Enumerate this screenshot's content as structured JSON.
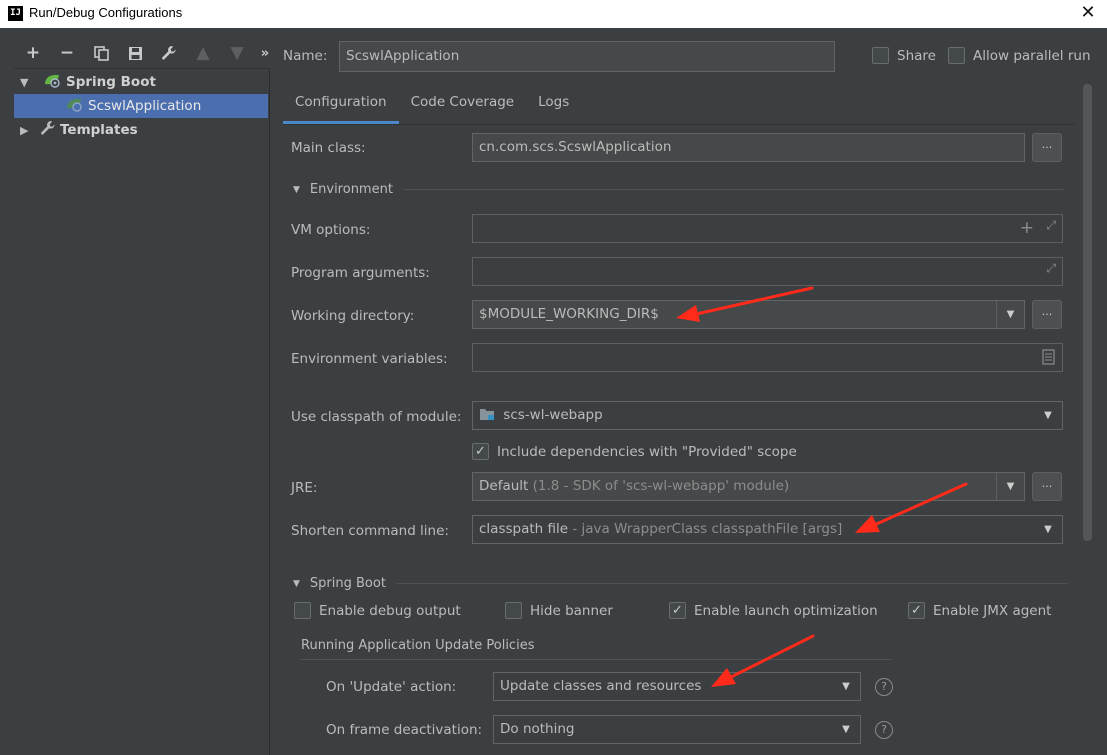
{
  "window": {
    "title": "Run/Debug Configurations",
    "app_icon": "IJ"
  },
  "toolbar": {
    "icons": [
      "add-icon",
      "remove-icon",
      "copy-icon",
      "save-icon",
      "wrench-icon",
      "move-up-icon",
      "move-down-icon",
      "more-icon"
    ]
  },
  "tree": {
    "spring_boot": "Spring Boot",
    "app": "ScswlApplication",
    "templates": "Templates"
  },
  "header": {
    "name_label": "Name:",
    "name_value": "ScswlApplication",
    "share_label": "Share",
    "parallel_label": "Allow parallel run"
  },
  "tabs": [
    "Configuration",
    "Code Coverage",
    "Logs"
  ],
  "config": {
    "main_class_label": "Main class:",
    "main_class_value": "cn.com.scs.ScswlApplication",
    "environment_section": "Environment",
    "vm_options_label": "VM options:",
    "program_args_label": "Program arguments:",
    "working_dir_label": "Working directory:",
    "working_dir_value": "$MODULE_WORKING_DIR$",
    "env_vars_label": "Environment variables:",
    "classpath_label": "Use classpath of module:",
    "classpath_value": "scs-wl-webapp",
    "include_deps_label": "Include dependencies with \"Provided\" scope",
    "jre_label": "JRE:",
    "jre_value": "Default",
    "jre_detail": "(1.8 - SDK of 'scs-wl-webapp' module)",
    "shorten_label": "Shorten command line:",
    "shorten_value": "classpath file",
    "shorten_detail": "- java WrapperClass classpathFile [args]"
  },
  "spring_boot": {
    "section": "Spring Boot",
    "debug_output": "Enable debug output",
    "hide_banner": "Hide banner",
    "launch_opt": "Enable launch optimization",
    "jmx_agent": "Enable JMX agent",
    "policies_title": "Running Application Update Policies",
    "update_action_label": "On 'Update' action:",
    "update_action_value": "Update classes and resources",
    "frame_deactivation_label": "On frame deactivation:",
    "frame_deactivation_value": "Do nothing"
  },
  "browse_label": "...",
  "help_label": "?",
  "accent_color": "#4b6eaf",
  "annotation_color": "#ff2a1a"
}
